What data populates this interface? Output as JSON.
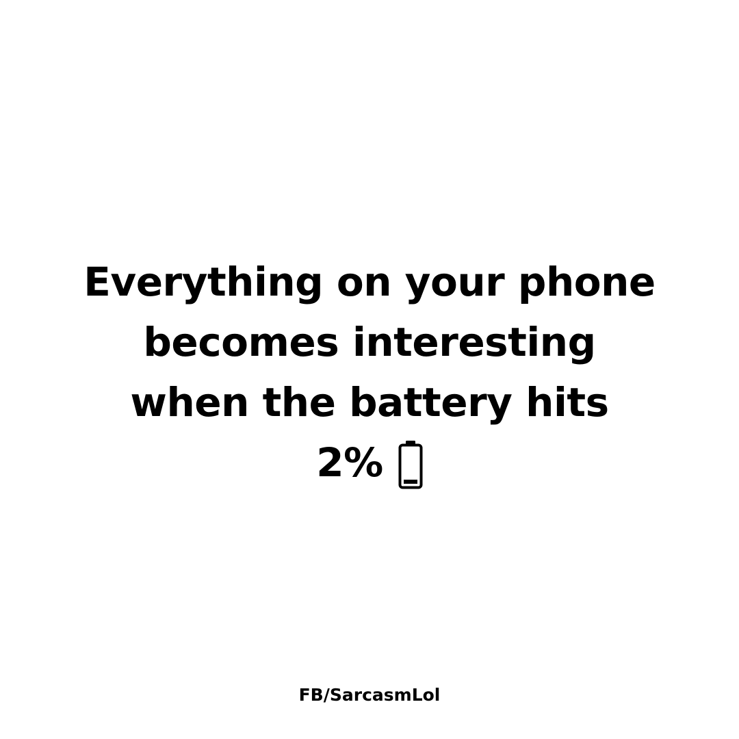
{
  "quote": {
    "lines": [
      "Everything on your phone",
      "becomes interesting",
      "when the battery hits"
    ],
    "last_value": "2%",
    "icon": "low-battery-icon",
    "battery_level_percent": 2
  },
  "footer": {
    "credit": "FB/SarcasmLol"
  },
  "colors": {
    "background": "#ffffff",
    "text": "#000000"
  }
}
